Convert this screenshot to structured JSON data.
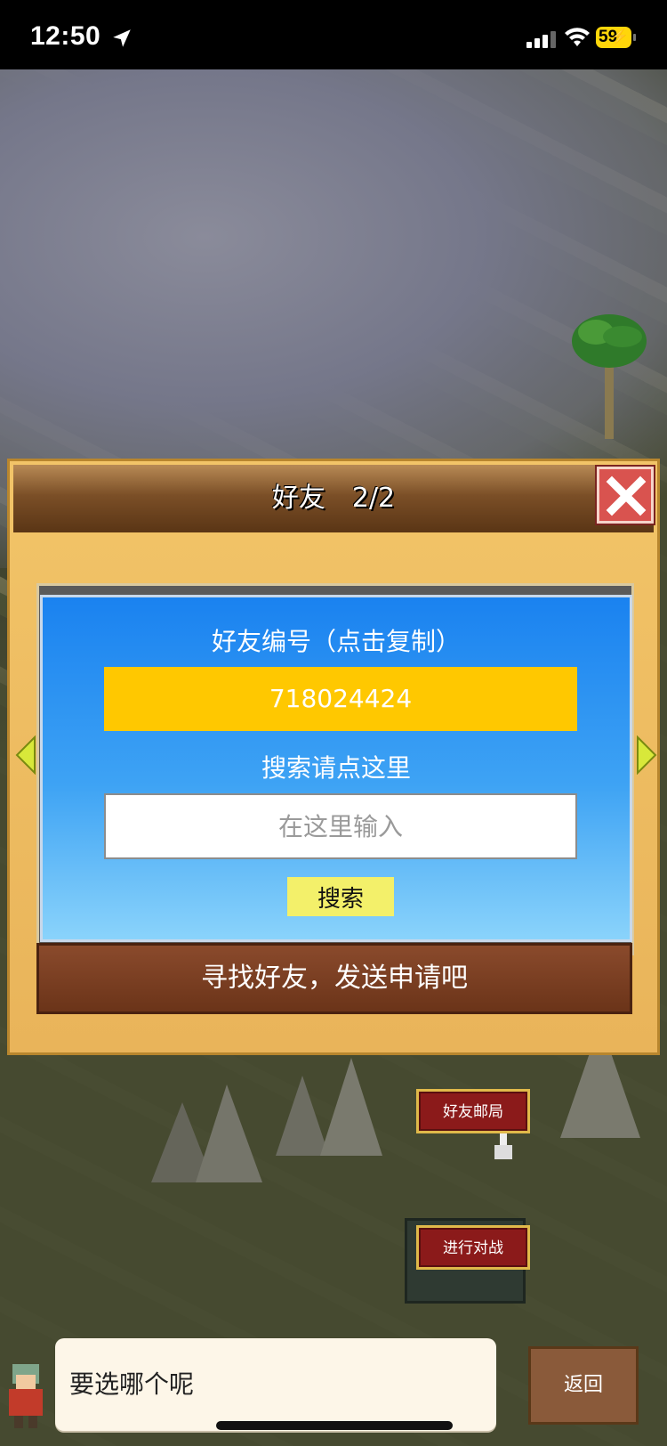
{
  "status_bar": {
    "time": "12:50",
    "battery": "59",
    "icons": [
      "location-arrow-icon",
      "signal-icon",
      "wifi-icon",
      "battery-charging-icon"
    ]
  },
  "dialog": {
    "title": "好友　2/2",
    "friend_id_label": "好友编号（点击复制）",
    "friend_id_value": "718024424",
    "search_label": "搜索请点这里",
    "search_placeholder": "在这里输入",
    "search_button": "搜索",
    "send_request_label": "寻找好友，发送申请吧"
  },
  "map_tags": {
    "post_office": "好友邮局",
    "battle": "进行对战"
  },
  "chat": {
    "message": "要选哪个呢",
    "back_button": "返回"
  },
  "colors": {
    "panel_blue": "#1a82f0",
    "id_field_yellow": "#ffc800",
    "search_button_yellow": "#f3f06a",
    "close_red": "#d9534f",
    "header_brown": "#7b4f27"
  }
}
